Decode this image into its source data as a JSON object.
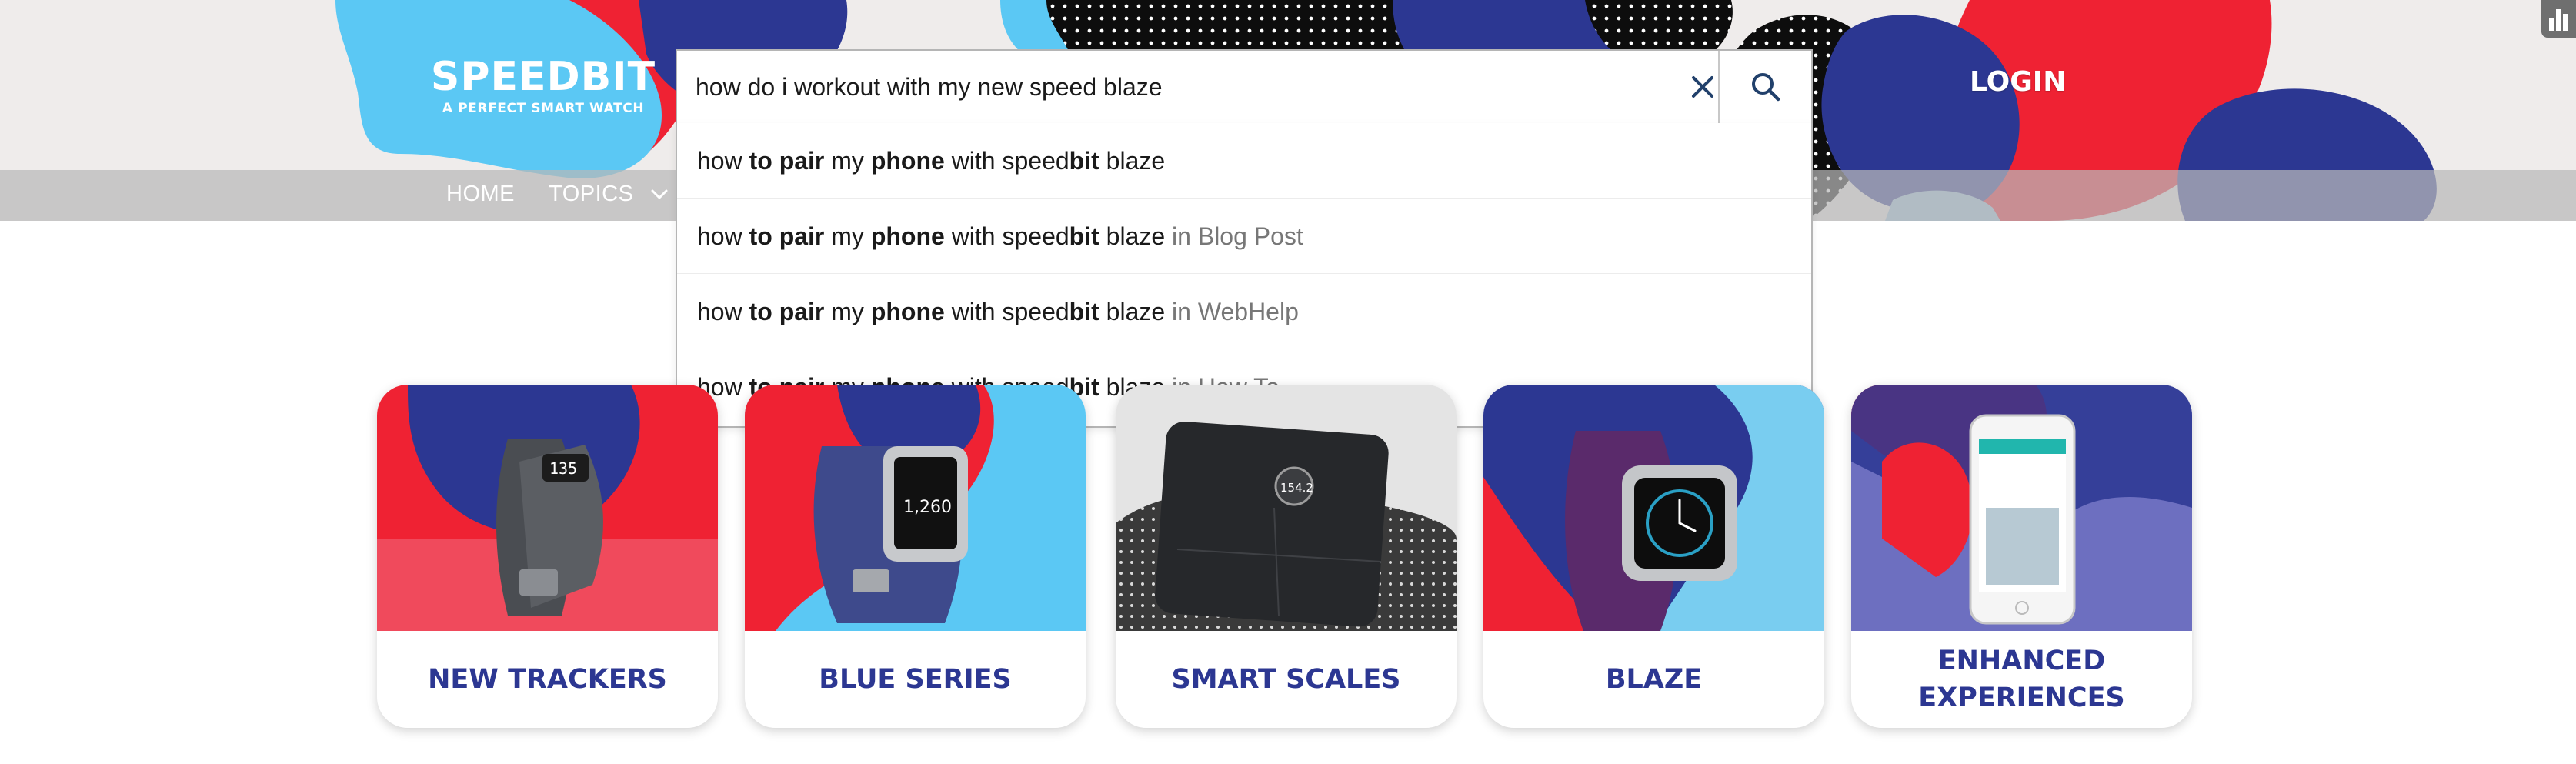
{
  "brand": {
    "logo_title": "SPEEDBIT",
    "logo_subtitle": "A PERFECT SMART WATCH"
  },
  "nav": {
    "home_label": "HOME",
    "topics_label": "TOPICS"
  },
  "header": {
    "login_label": "LOGIN"
  },
  "colors": {
    "brand_red": "#ef2233",
    "brand_navy": "#2c3792",
    "brand_sky": "#5bc8f4",
    "title_text": "#2c3792"
  },
  "search": {
    "query": "how do i workout with my new speed blaze",
    "clear_icon": "close-icon",
    "submit_icon": "search-icon"
  },
  "suggestions": [
    {
      "parts": [
        [
          "how ",
          false
        ],
        [
          "to pair",
          true
        ],
        [
          " my ",
          false
        ],
        [
          "phone",
          true
        ],
        [
          " with speed",
          false
        ],
        [
          "bit",
          true
        ],
        [
          " blaze",
          false
        ]
      ],
      "context": ""
    },
    {
      "parts": [
        [
          "how ",
          false
        ],
        [
          "to pair",
          true
        ],
        [
          " my ",
          false
        ],
        [
          "phone",
          true
        ],
        [
          " with speed",
          false
        ],
        [
          "bit",
          true
        ],
        [
          " blaze",
          false
        ]
      ],
      "context": " in Blog Post"
    },
    {
      "parts": [
        [
          "how ",
          false
        ],
        [
          "to pair",
          true
        ],
        [
          " my ",
          false
        ],
        [
          "phone",
          true
        ],
        [
          " with speed",
          false
        ],
        [
          "bit",
          true
        ],
        [
          " blaze",
          false
        ]
      ],
      "context": " in WebHelp"
    },
    {
      "parts": [
        [
          "how ",
          false
        ],
        [
          "to pair",
          true
        ],
        [
          " my ",
          false
        ],
        [
          "phone",
          true
        ],
        [
          " with speed",
          false
        ],
        [
          "bit",
          true
        ],
        [
          " blaze",
          false
        ]
      ],
      "context": " in How To"
    }
  ],
  "cards": [
    {
      "title": "NEW TRACKERS",
      "image_icon": "tracker-band-icon",
      "device_screen": "135"
    },
    {
      "title": "BLUE SERIES",
      "image_icon": "blue-tracker-icon",
      "device_screen": "1,260"
    },
    {
      "title": "SMART SCALES",
      "image_icon": "smart-scale-icon",
      "device_screen": "154.2"
    },
    {
      "title": "BLAZE",
      "image_icon": "blaze-watch-icon",
      "device_screen": ""
    },
    {
      "title": "ENHANCED EXPERIENCES",
      "image_icon": "phone-app-icon",
      "device_screen": ""
    }
  ]
}
